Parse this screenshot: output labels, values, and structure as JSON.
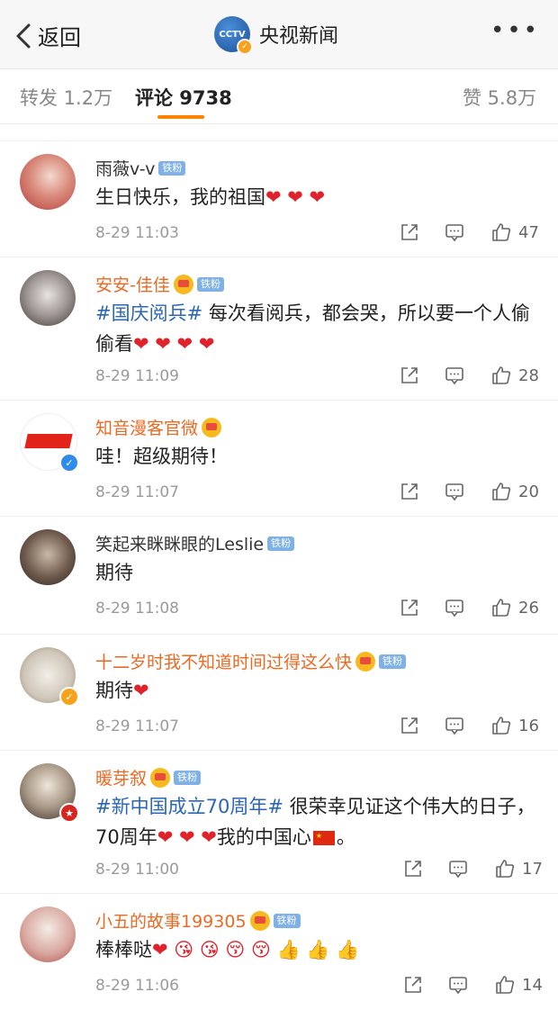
{
  "header": {
    "back_label": "返回",
    "logo_text": "CCTV",
    "title": "央视新闻",
    "more_label": "•••"
  },
  "tabs": {
    "reposts": "转发 1.2万",
    "comments": "评论 9738",
    "likes": "赞 5.8万"
  },
  "fan_badge": "铁粉",
  "comments": [
    {
      "name": "雨薇v-v",
      "text": "生日快乐，我的祖国",
      "emoji": "❤ ❤ ❤",
      "time": "8-29 11:03",
      "likes": "47"
    },
    {
      "name": "安安-佳佳",
      "hashtag": "#国庆阅兵#",
      "text": " 每次看阅兵，都会哭，所以要一个人偷偷看",
      "emoji": "❤ ❤ ❤ ❤",
      "time": "8-29 11:09",
      "likes": "28"
    },
    {
      "name": "知音漫客官微",
      "text": "哇！超级期待！",
      "time": "8-29 11:07",
      "likes": "20"
    },
    {
      "name": "笑起来眯眯眼的Leslie",
      "text": "期待",
      "time": "8-29 11:08",
      "likes": "26"
    },
    {
      "name": "十二岁时我不知道时间过得这么快",
      "text": "期待",
      "emoji": "❤",
      "time": "8-29 11:07",
      "likes": "16"
    },
    {
      "name": "暖芽叙",
      "hashtag": "#新中国成立70周年#",
      "text": " 很荣幸见证这个伟大的日子，70周年",
      "emoji": "❤ ❤ ❤",
      "text2": "我的中国心",
      "text3": "。",
      "time": "8-29 11:00",
      "likes": "17"
    },
    {
      "name": "小五的故事199305",
      "text": "棒棒哒",
      "emoji": "❤ 😘 😘 😚 😚 👍 👍 👍",
      "time": "8-29 11:06",
      "likes": "14"
    }
  ],
  "colors": {
    "accent": "#ff8200",
    "vip_name": "#ea6a23",
    "hashtag": "#2b66b7",
    "heart": "#e0222a"
  }
}
